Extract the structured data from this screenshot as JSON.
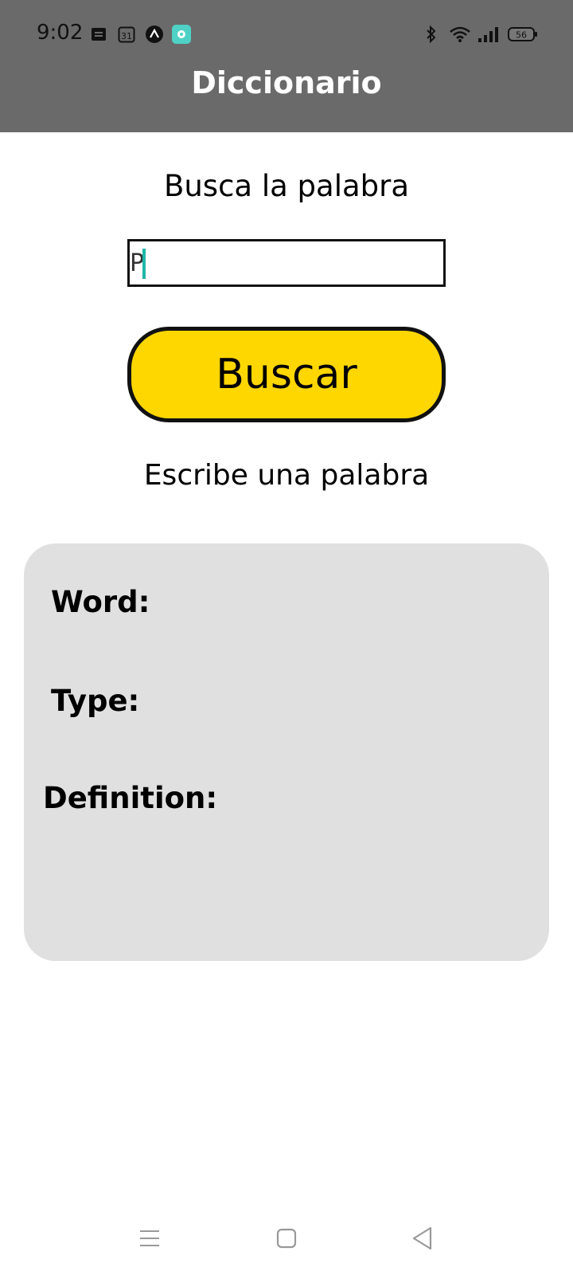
{
  "status_bar": {
    "time": "9:02",
    "left_icons": [
      "notes-icon",
      "calendar-icon",
      "arrow-app-icon",
      "chat-app-icon"
    ],
    "calendar_day": "31",
    "right_icons": [
      "bluetooth-icon",
      "wifi-icon",
      "signal-icon",
      "battery-icon"
    ],
    "battery_level": "56"
  },
  "app_bar": {
    "title": "Diccionario"
  },
  "search": {
    "prompt": "Busca la palabra",
    "input_value": "P",
    "button_label": "Buscar",
    "message": "Escribe una palabra"
  },
  "result_card": {
    "word_label": "Word:",
    "type_label": "Type:",
    "definition_label": "Definition:"
  },
  "nav_bar": {
    "icons": [
      "menu-icon",
      "home-icon",
      "back-icon"
    ]
  },
  "colors": {
    "app_bar": "#6a6a6a",
    "button": "#ffd700",
    "card": "#e0e0e0",
    "caret": "#1fb7a8"
  }
}
